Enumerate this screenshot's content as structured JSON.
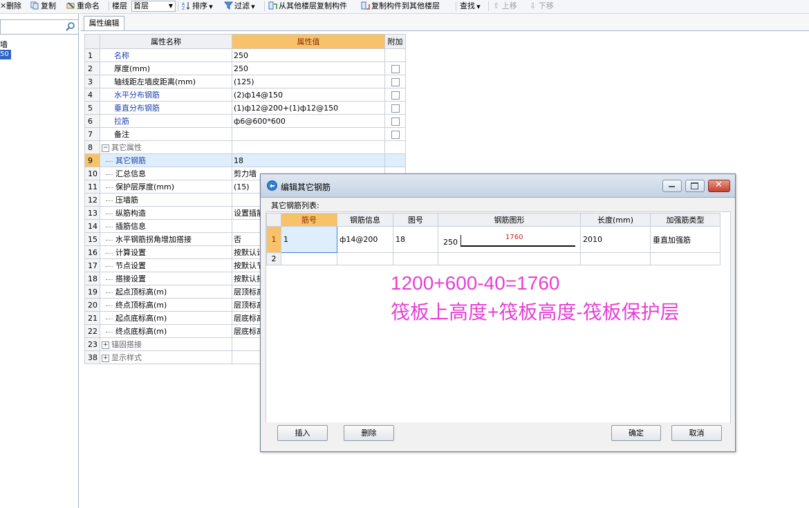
{
  "toolbar": {
    "delete": "删除",
    "copy": "复制",
    "rename": "重命名",
    "floor_label": "楼层",
    "floor_value": "首层",
    "sort": "排序",
    "filter": "过滤",
    "copy_from_floor": "从其他楼层复制构件",
    "copy_to_floor": "复制构件到其他楼层",
    "find": "查找",
    "move_up": "上移",
    "move_down": "下移"
  },
  "left": {
    "item1": "墙",
    "item2": "50"
  },
  "tab": {
    "label": "属性编辑"
  },
  "grid": {
    "headers": {
      "name": "属性名称",
      "value": "属性值",
      "extra": "附加"
    },
    "rows": [
      {
        "no": "1",
        "name": "名称",
        "value": "250",
        "checkbox": false
      },
      {
        "no": "2",
        "name": "厚度(mm)",
        "value": "250",
        "checkbox": true
      },
      {
        "no": "3",
        "name": "轴线距左墙皮距离(mm)",
        "value": "(125)",
        "checkbox": true
      },
      {
        "no": "4",
        "name": "水平分布钢筋",
        "value": "(2)ф14@150",
        "checkbox": true
      },
      {
        "no": "5",
        "name": "垂直分布钢筋",
        "value": "(1)ф12@200+(1)ф12@150",
        "checkbox": true
      },
      {
        "no": "6",
        "name": "拉筋",
        "value": "ф6@600*600",
        "checkbox": true
      },
      {
        "no": "7",
        "name": "备注",
        "value": "",
        "checkbox": true
      },
      {
        "no": "8",
        "name": "其它属性",
        "value": ""
      },
      {
        "no": "9",
        "name": "其它钢筋",
        "value": "18"
      },
      {
        "no": "10",
        "name": "汇总信息",
        "value": "剪力墙"
      },
      {
        "no": "11",
        "name": "保护层厚度(mm)",
        "value": "(15)"
      },
      {
        "no": "12",
        "name": "压墙筋",
        "value": ""
      },
      {
        "no": "13",
        "name": "纵筋构造",
        "value": "设置插筋"
      },
      {
        "no": "14",
        "name": "插筋信息",
        "value": ""
      },
      {
        "no": "15",
        "name": "水平钢筋拐角增加搭接",
        "value": "否"
      },
      {
        "no": "16",
        "name": "计算设置",
        "value": "按默认计"
      },
      {
        "no": "17",
        "name": "节点设置",
        "value": "按默认节"
      },
      {
        "no": "18",
        "name": "搭接设置",
        "value": "按默认搭"
      },
      {
        "no": "19",
        "name": "起点顶标高(m)",
        "value": "层顶标高"
      },
      {
        "no": "20",
        "name": "终点顶标高(m)",
        "value": "层顶标高"
      },
      {
        "no": "21",
        "name": "起点底标高(m)",
        "value": "层底标高"
      },
      {
        "no": "22",
        "name": "终点底标高(m)",
        "value": "层底标高"
      },
      {
        "no": "23",
        "name": "锚固搭接",
        "value": ""
      },
      {
        "no": "38",
        "name": "显示样式",
        "value": ""
      }
    ]
  },
  "dialog": {
    "title": "编辑其它钢筋",
    "list_label": "其它钢筋列表:",
    "headers": {
      "bar_no": "筋号",
      "bar_info": "钢筋信息",
      "fig_no": "图号",
      "bar_shape": "钢筋图形",
      "length": "长度(mm)",
      "strengthen_type": "加强筋类型"
    },
    "row1": {
      "no": "1",
      "bar_no": "1",
      "bar_info": "ф14@200",
      "fig_no": "18",
      "shape_left": "250",
      "shape_length": "1760",
      "length": "2010",
      "strengthen_type": "垂直加强筋"
    },
    "row2": {
      "no": "2"
    },
    "annotation_line1": "1200+600-40=1760",
    "annotation_line2": "筏板上高度+筏板高度-筏板保护层",
    "buttons": {
      "insert": "插入",
      "delete": "删除",
      "ok": "确定",
      "cancel": "取消"
    }
  }
}
